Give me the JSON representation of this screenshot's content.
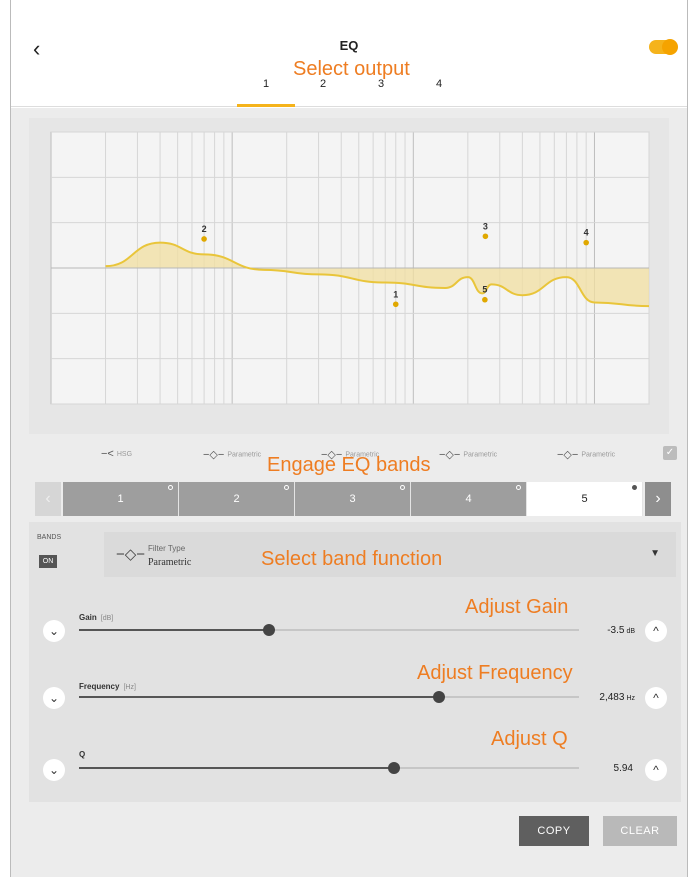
{
  "header": {
    "title": "EQ",
    "back_icon": "chevron-left-icon",
    "output_tabs": [
      "1",
      "2",
      "3",
      "4"
    ],
    "active_output_tab": "1",
    "enabled": true
  },
  "annotations": {
    "select_output": "Select output",
    "engage_bands": "Engage EQ bands",
    "select_function": "Select band function",
    "adjust_gain": "Adjust Gain",
    "adjust_frequency": "Adjust Frequency",
    "adjust_q": "Adjust Q"
  },
  "chart_data": {
    "type": "line",
    "series": [
      {
        "values": [
          [
            20,
            0.2
          ],
          [
            40,
            2.8
          ],
          [
            70,
            1.5
          ],
          [
            150,
            -0.2
          ],
          [
            300,
            -0.7
          ],
          [
            700,
            -1.6
          ],
          [
            1500,
            -2.2
          ],
          [
            2000,
            -1.0
          ],
          [
            2400,
            -2.8
          ],
          [
            2700,
            -1.8
          ],
          [
            4000,
            -3.0
          ],
          [
            7000,
            -1.0
          ],
          [
            10000,
            -3.8
          ],
          [
            20000,
            -4.2
          ]
        ]
      }
    ],
    "band_markers": [
      {
        "label": "1",
        "x": 800,
        "y": -4
      },
      {
        "label": "2",
        "x": 70,
        "y": 3.2
      },
      {
        "label": "3",
        "x": 2500,
        "y": 3.5
      },
      {
        "label": "4",
        "x": 9000,
        "y": 2.8
      },
      {
        "label": "5",
        "x": 2483,
        "y": -3.5
      }
    ],
    "colors": {
      "curve": "#e9c53a",
      "fill": "#f2dfa0",
      "marker": "#e0a800"
    }
  },
  "filters": [
    {
      "icon": "high-shelf-icon",
      "label": "HSG"
    },
    {
      "icon": "parametric-icon",
      "label": "Parametric"
    },
    {
      "icon": "parametric-icon",
      "label": "Parametric"
    },
    {
      "icon": "parametric-icon",
      "label": "Parametric"
    },
    {
      "icon": "parametric-icon",
      "label": "Parametric"
    }
  ],
  "bands": [
    "1",
    "2",
    "3",
    "4",
    "5"
  ],
  "active_band": "5",
  "band_panel": {
    "bands_label": "BANDS",
    "bands_state": "ON",
    "filter_type_label": "Filter Type",
    "filter_type_value": "Parametric"
  },
  "sliders": {
    "gain": {
      "label": "Gain",
      "unit": "[dB]",
      "value": "-3.5",
      "value_unit": "dB",
      "level": 0.38
    },
    "frequency": {
      "label": "Frequency",
      "unit": "[Hz]",
      "value": "2,483",
      "value_unit": "Hz",
      "level": 0.72
    },
    "q": {
      "label": "Q",
      "unit": "",
      "value": "5.94",
      "value_unit": "",
      "level": 0.63
    }
  },
  "buttons": {
    "copy": "COPY",
    "clear": "CLEAR"
  },
  "colors": {
    "accent": "#f5b31b",
    "annotation": "#ee7d22"
  }
}
